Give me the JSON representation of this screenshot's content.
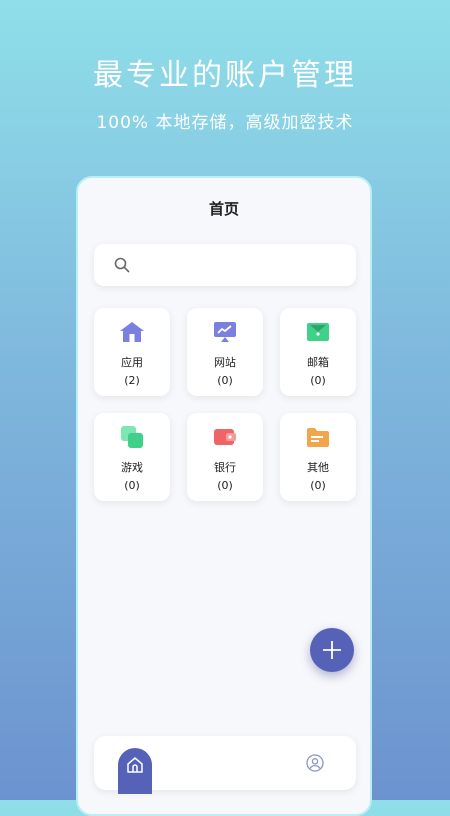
{
  "hero": {
    "title": "最专业的账户管理",
    "subtitle": "100% 本地存储，高级加密技术"
  },
  "page": {
    "title": "首页"
  },
  "search": {
    "placeholder": "",
    "value": "",
    "icon": "search-icon"
  },
  "categories": [
    {
      "label": "应用",
      "count": "(2)",
      "icon": "house-icon",
      "color": "#7b7fe0"
    },
    {
      "label": "网站",
      "count": "(0)",
      "icon": "monitor-chart-icon",
      "color": "#7b7fe0"
    },
    {
      "label": "邮箱",
      "count": "(0)",
      "icon": "envelope-icon",
      "color": "#3fd08a"
    },
    {
      "label": "游戏",
      "count": "(0)",
      "icon": "squares-icon",
      "color": "#3fd08a"
    },
    {
      "label": "银行",
      "count": "(0)",
      "icon": "wallet-icon",
      "color": "#ef6464"
    },
    {
      "label": "其他",
      "count": "(0)",
      "icon": "folder-icon",
      "color": "#f2a54a"
    }
  ],
  "fab": {
    "icon": "plus-icon",
    "color": "#5562b8"
  },
  "bottom_nav": {
    "home_icon": "home-icon",
    "profile_icon": "user-circle-icon",
    "active_color": "#5562b8"
  }
}
